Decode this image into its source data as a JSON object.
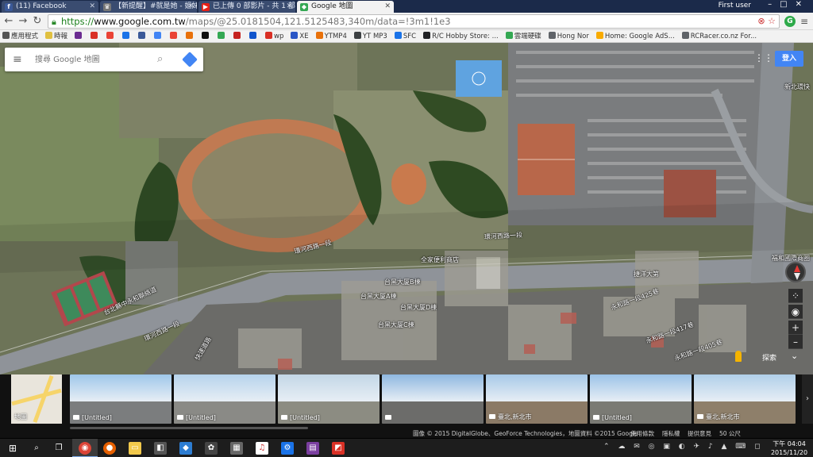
{
  "browser": {
    "tabs": [
      {
        "title": "(11) Facebook",
        "color": "#3b5998",
        "glyph": "f"
      },
      {
        "title": "【新提醒】#就是她 - 姐妹",
        "color": "#777777",
        "glyph": ""
      },
      {
        "title": "已上傳 0 部影片 - 共 1 部",
        "color": "#e62117",
        "glyph": ""
      },
      {
        "title": "Google 地圖",
        "color": "#34a853",
        "glyph": ""
      }
    ],
    "user": "First user",
    "url": {
      "scheme": "https://",
      "host": "www.google.com.tw",
      "path": "/maps/@25.0181504,121.5125483,340m/data=!3m1!1e3"
    },
    "bookmarks": [
      {
        "label": "應用程式",
        "color": "#555555"
      },
      {
        "label": "時報",
        "color": "#e0c040"
      },
      {
        "label": "",
        "color": "#6b2c91"
      },
      {
        "label": "",
        "color": "#d93025"
      },
      {
        "label": "",
        "color": "#ea4335"
      },
      {
        "label": "",
        "color": "#1a73e8"
      },
      {
        "label": "",
        "color": "#3b5998"
      },
      {
        "label": "",
        "color": "#4285f4"
      },
      {
        "label": "",
        "color": "#ea4335"
      },
      {
        "label": "",
        "color": "#e8710a"
      },
      {
        "label": "",
        "color": "#111111"
      },
      {
        "label": "",
        "color": "#34a853"
      },
      {
        "label": "",
        "color": "#c5221f"
      },
      {
        "label": "",
        "color": "#1155cc"
      },
      {
        "label": "wp",
        "color": "#d93025"
      },
      {
        "label": "XE",
        "color": "#2a56c6"
      },
      {
        "label": "YTMP4",
        "color": "#e8710a"
      },
      {
        "label": "YT MP3",
        "color": "#3c4043"
      },
      {
        "label": "SFC",
        "color": "#1a73e8"
      },
      {
        "label": "R/C Hobby Store: ...",
        "color": "#202124"
      },
      {
        "label": "雲端硬碟",
        "color": "#34a853"
      },
      {
        "label": "Hong Nor",
        "color": "#5f6368"
      },
      {
        "label": "Home: Google AdS...",
        "color": "#f9ab00"
      },
      {
        "label": "RCRacer.co.nz For...",
        "color": "#5f6368"
      }
    ]
  },
  "maps": {
    "search_placeholder": "搜尋 Google 地圖",
    "signin_label": "登入",
    "explore_label": "探索",
    "labels": [
      {
        "text": "環河西路一段"
      },
      {
        "text": "環河西路一段"
      },
      {
        "text": "全家便利商店"
      },
      {
        "text": "台黑大厦B棟"
      },
      {
        "text": "台黑大厦A棟"
      },
      {
        "text": "台黑大厦D棟"
      },
      {
        "text": "台黑大厦C棟"
      },
      {
        "text": "捷洋大第"
      },
      {
        "text": "永和路一段425巷"
      },
      {
        "text": "永和路一段417巷"
      },
      {
        "text": "永和路一段405巷"
      },
      {
        "text": "台北縣中永和聯絡道"
      },
      {
        "text": "環河西路一段"
      },
      {
        "text": "快速道路"
      },
      {
        "text": "福和國際商圈"
      },
      {
        "text": "新北環快"
      }
    ]
  },
  "photo_strip": {
    "map_thumb_label": "地圖",
    "items": [
      {
        "caption": "[Untitled]"
      },
      {
        "caption": "[Untitled]"
      },
      {
        "caption": "[Untitled]"
      },
      {
        "caption": ""
      },
      {
        "caption": "臺北,新北市"
      },
      {
        "caption": "[Untitled]"
      },
      {
        "caption": "臺北,新北市"
      }
    ]
  },
  "footer": {
    "attribution": "圖像 © 2015 DigitalGlobe、GeoForce Technologies，地圖資料 ©2015 Google",
    "terms": "使用條款",
    "privacy": "隱私權",
    "feedback": "提供意見",
    "scale": "50 公尺"
  },
  "taskbar": {
    "time": "下午 04:04",
    "date": "2015/11/20"
  }
}
